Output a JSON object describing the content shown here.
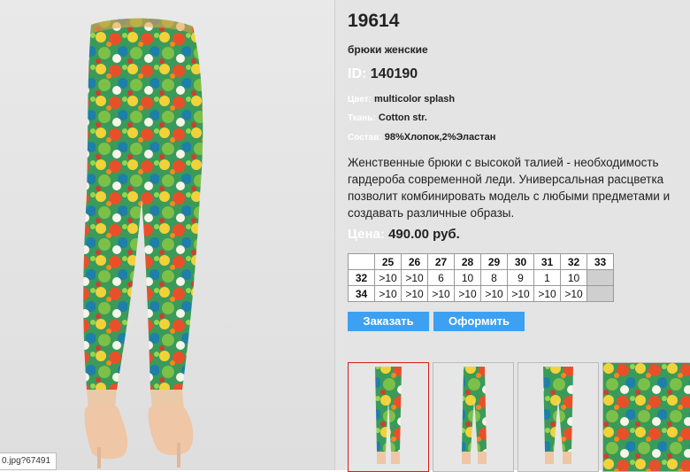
{
  "product": {
    "article": "19614",
    "subtitle": "брюки женские",
    "id_label": "ID:",
    "id_value": "140190",
    "color_label": "Цвет:",
    "color_value": "multicolor splash",
    "fabric_label": "Ткань:",
    "fabric_value": "Cotton str.",
    "composition_label": "Состав:",
    "composition_value": "98%Хлопок,2%Эластан",
    "description": "Женственные  брюки с высокой талией - необходимость гардероба современной леди. Универсальная расцветка позволит комбинировать модель с любыми предметами и создавать различные образы.",
    "price_label": "Цена:",
    "price_value": "490.00 руб."
  },
  "size_table": {
    "columns": [
      "25",
      "26",
      "27",
      "28",
      "29",
      "30",
      "31",
      "32",
      "33"
    ],
    "rows": [
      {
        "height": "32",
        "values": [
          ">10",
          ">10",
          "6",
          "10",
          "8",
          "9",
          "1",
          "10",
          ""
        ]
      },
      {
        "height": "34",
        "values": [
          ">10",
          ">10",
          ">10",
          ">10",
          ">10",
          ">10",
          ">10",
          ">10",
          ""
        ]
      }
    ]
  },
  "buttons": {
    "order": "Заказать",
    "checkout": "Оформить"
  },
  "status_bar": {
    "text": "0.jpg?67491"
  },
  "colors": {
    "panel_bg": "#e4e4e4",
    "button_bg": "#3ea0f0",
    "selected_thumb_border": "#d02020"
  }
}
